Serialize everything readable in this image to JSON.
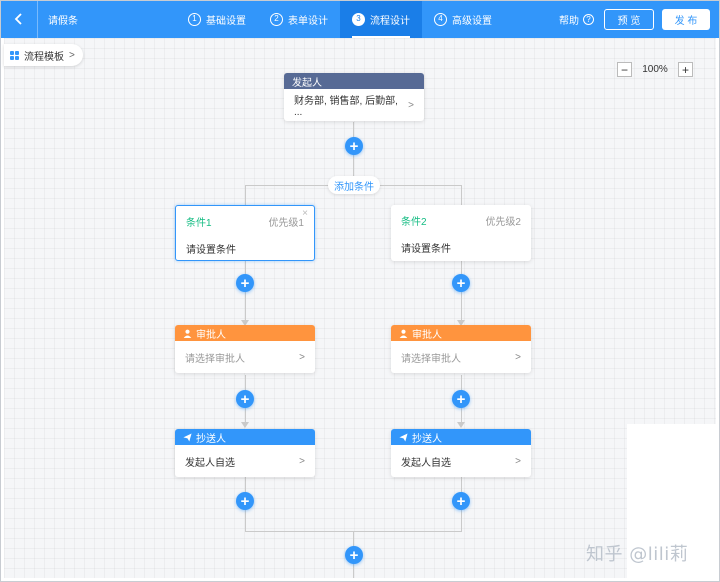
{
  "header": {
    "back_icon": "chevron-left-icon",
    "title": "请假条",
    "steps": [
      {
        "num": "1",
        "label": "基础设置",
        "active": false
      },
      {
        "num": "2",
        "label": "表单设计",
        "active": false
      },
      {
        "num": "3",
        "label": "流程设计",
        "active": true
      },
      {
        "num": "4",
        "label": "高级设置",
        "active": false
      }
    ],
    "help_label": "帮助",
    "help_icon": "?",
    "preview_label": "预 览",
    "publish_label": "发 布",
    "accent_color": "#3296fa"
  },
  "toolbar": {
    "template_label": "流程模板",
    "template_chevron": ">",
    "zoom_out": "−",
    "zoom_value": "100%",
    "zoom_in": "+"
  },
  "flow": {
    "initiator": {
      "title": "发起人",
      "value": "财务部, 销售部, 后勤部, ...",
      "chevron": ">",
      "color": "#576a95"
    },
    "add_condition_label": "添加条件",
    "add_symbol": "+",
    "branches": [
      {
        "condition": {
          "name": "条件1",
          "priority": "优先级1",
          "text": "请设置条件",
          "close": "×"
        },
        "approver": {
          "title": "审批人",
          "placeholder": "请选择审批人",
          "chevron": ">",
          "color": "#ff943e"
        },
        "cc": {
          "title": "抄送人",
          "value": "发起人自选",
          "chevron": ">",
          "color": "#3296fa"
        }
      },
      {
        "condition": {
          "name": "条件2",
          "priority": "优先级2",
          "text": "请设置条件"
        },
        "approver": {
          "title": "审批人",
          "placeholder": "请选择审批人",
          "chevron": ">",
          "color": "#ff943e"
        },
        "cc": {
          "title": "抄送人",
          "value": "发起人自选",
          "chevron": ">",
          "color": "#3296fa"
        }
      }
    ]
  },
  "watermark": "知乎 @lili莉"
}
